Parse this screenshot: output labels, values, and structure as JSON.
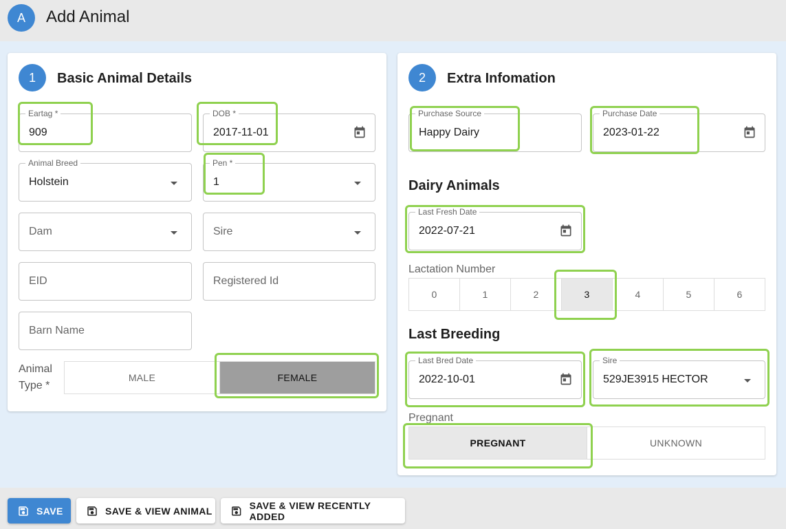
{
  "header": {
    "avatar_letter": "A",
    "title": "Add Animal"
  },
  "card1": {
    "step": "1",
    "title": "Basic Animal Details",
    "eartag": {
      "label": "Eartag *",
      "value": "909"
    },
    "dob": {
      "label": "DOB *",
      "value": "2017-11-01"
    },
    "breed": {
      "label": "Animal Breed",
      "value": "Holstein"
    },
    "pen": {
      "label": "Pen *",
      "value": "1"
    },
    "dam": {
      "placeholder": "Dam"
    },
    "sire": {
      "placeholder": "Sire"
    },
    "eid": {
      "placeholder": "EID"
    },
    "registered_id": {
      "placeholder": "Registered Id"
    },
    "barn_name": {
      "placeholder": "Barn Name"
    },
    "animal_type": {
      "label": "Animal Type *",
      "options": [
        "MALE",
        "FEMALE"
      ],
      "selected": "FEMALE"
    }
  },
  "card2": {
    "step": "2",
    "title": "Extra Infomation",
    "purchase_source": {
      "label": "Purchase Source",
      "value": "Happy Dairy"
    },
    "purchase_date": {
      "label": "Purchase Date",
      "value": "2023-01-22"
    },
    "dairy_title": "Dairy Animals",
    "last_fresh": {
      "label": "Last Fresh Date",
      "value": "2022-07-21"
    },
    "lactation": {
      "label": "Lactation Number",
      "options": [
        "0",
        "1",
        "2",
        "3",
        "4",
        "5",
        "6"
      ],
      "selected": "3"
    },
    "breeding_title": "Last Breeding",
    "last_bred": {
      "label": "Last Bred Date",
      "value": "2022-10-01"
    },
    "sire": {
      "label": "Sire",
      "value": "529JE3915 HECTOR"
    },
    "pregnant": {
      "label": "Pregnant",
      "options": [
        "PREGNANT",
        "UNKNOWN"
      ],
      "selected": "PREGNANT"
    }
  },
  "actions": {
    "save": "SAVE",
    "save_view_animal": "SAVE & VIEW ANIMAL",
    "save_view_recent": "SAVE & VIEW RECENTLY ADDED"
  },
  "colors": {
    "accent": "#3f87d2",
    "highlight": "#8fd14f",
    "background": "#e3eef9"
  },
  "icons": {
    "calendar": "calendar-icon",
    "save": "save-icon",
    "dropdown": "chevron-down-icon"
  }
}
